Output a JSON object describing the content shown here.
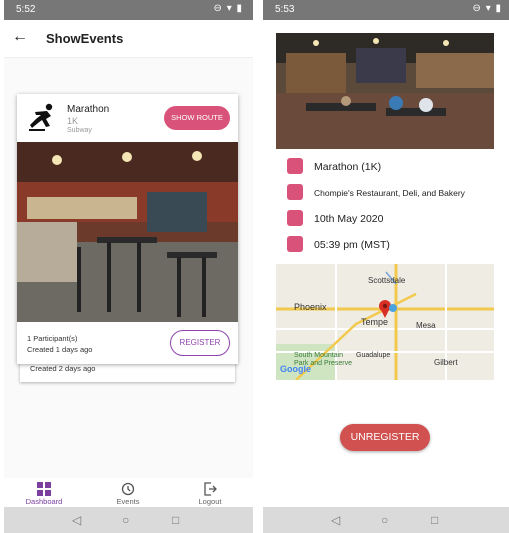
{
  "left": {
    "status": {
      "time": "5:52"
    },
    "appbar": {
      "title": "ShowEvents"
    },
    "event_card": {
      "name": "Marathon",
      "distance": "1K",
      "location": "Subway",
      "route_label": "SHOW ROUTE",
      "participants": "1 Participant(s)",
      "created": "Created 1 days ago",
      "register_label": "REGISTER"
    },
    "second_card": {
      "created": "Created 2 days ago"
    },
    "bottom_nav": [
      {
        "label": "Dashboard",
        "icon": "dashboard-icon",
        "active": true
      },
      {
        "label": "Events",
        "icon": "history-icon",
        "active": false
      },
      {
        "label": "Logout",
        "icon": "logout-icon",
        "active": false
      }
    ]
  },
  "right": {
    "status": {
      "time": "5:53"
    },
    "details": {
      "event": "Marathon (1K)",
      "venue": "Chompie's Restaurant, Deli, and Bakery",
      "date": "10th May 2020",
      "time": "05:39 pm (MST)"
    },
    "map": {
      "labels": [
        "Scottsdale",
        "Phoenix",
        "Tempe",
        "Mesa",
        "South Mountain Park and Preserve",
        "Guadalupe",
        "Gilbert",
        "Google"
      ]
    },
    "unregister_label": "UNREGISTER"
  },
  "colors": {
    "accent_pink": "#d9527a",
    "accent_purple": "#8e44ad",
    "unregister_red": "#d0514f"
  }
}
